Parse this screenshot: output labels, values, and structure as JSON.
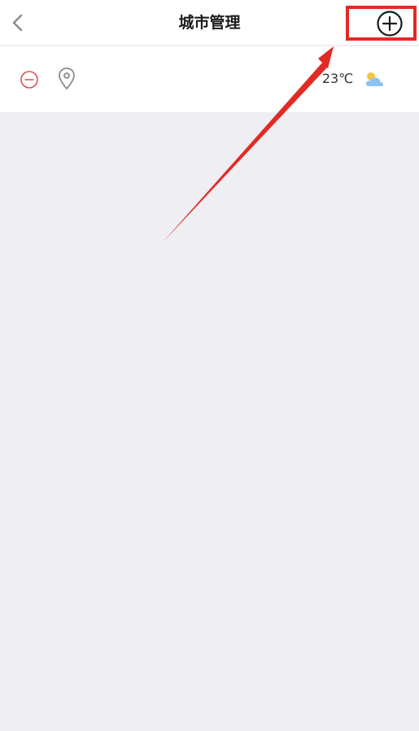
{
  "header": {
    "title": "城市管理",
    "back_icon": "chevron-left-icon",
    "add_icon": "plus-circle-icon"
  },
  "cities": [
    {
      "temperature": "23℃",
      "remove_icon": "minus-circle-icon",
      "location_icon": "location-pin-icon",
      "weather_icon": "partly-cloudy-icon"
    }
  ],
  "colors": {
    "background": "#efeef2",
    "surface": "#ffffff",
    "remove_red": "#d9534f",
    "annotation_red": "#e22a25",
    "icon_gray": "#8a8a8a"
  }
}
